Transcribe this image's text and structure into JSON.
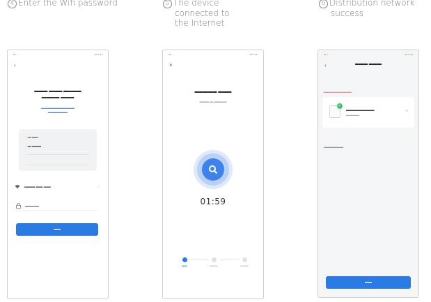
{
  "captions": [
    {
      "num": "4",
      "lines": [
        "Enter the Wifi password"
      ]
    },
    {
      "num": "5",
      "lines": [
        "The device",
        "connected to",
        "the Internet"
      ]
    },
    {
      "num": "6",
      "lines": [
        "Distribution network",
        "success"
      ]
    }
  ],
  "phone1": {
    "status_left": "",
    "status_right": "",
    "title": "",
    "subtitle": "",
    "wifi_name": "",
    "password_label": "",
    "next_button": ""
  },
  "phone2": {
    "title": "",
    "subtitle": "",
    "timer": "01:59",
    "steps": [
      "",
      "",
      ""
    ]
  },
  "phone3": {
    "title": "",
    "device_name": "",
    "device_sub": "",
    "done_button": ""
  },
  "colors": {
    "accent": "#2a7ae4",
    "success": "#3cc46b"
  }
}
